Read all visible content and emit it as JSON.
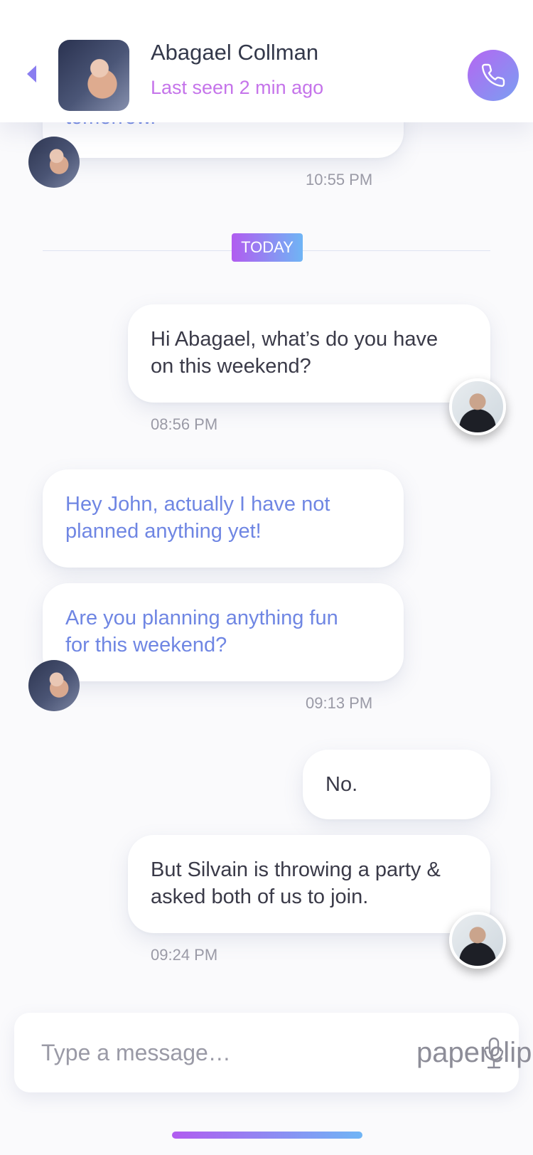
{
  "header": {
    "contact_name": "Abagael Collman",
    "status": "Last seen 2 min ago",
    "back_icon": "chevron-left-icon",
    "call_icon": "phone-icon",
    "accent": "#c574ea"
  },
  "divider": {
    "label": "TODAY"
  },
  "messages": [
    {
      "from": "contact",
      "lines": [
        "tomorrow."
      ],
      "time": "10:55 PM"
    },
    {
      "from": "me",
      "lines": [
        "Hi Abagael, what’s do you have",
        "on this weekend?"
      ],
      "time": "08:56 PM"
    },
    {
      "from": "contact",
      "lines": [
        "Hey John, actually I have not",
        "planned anything yet!"
      ]
    },
    {
      "from": "contact",
      "lines": [
        "Are you planning anything fun",
        "for this weekend?"
      ],
      "time": "09:13 PM"
    },
    {
      "from": "me",
      "lines": [
        "No."
      ]
    },
    {
      "from": "me",
      "lines": [
        "But Silvain is throwing a party &",
        "asked both of us to join."
      ],
      "time": "09:24 PM"
    }
  ],
  "composer": {
    "placeholder": "Type a message…",
    "attach_label": "paperclip",
    "mic_icon": "microphone-icon"
  },
  "colors": {
    "incoming_text": "#6f86e3",
    "outgoing_text": "#3a3a48",
    "gradient_start": "#b15cf0",
    "gradient_end": "#6fb5f5"
  }
}
